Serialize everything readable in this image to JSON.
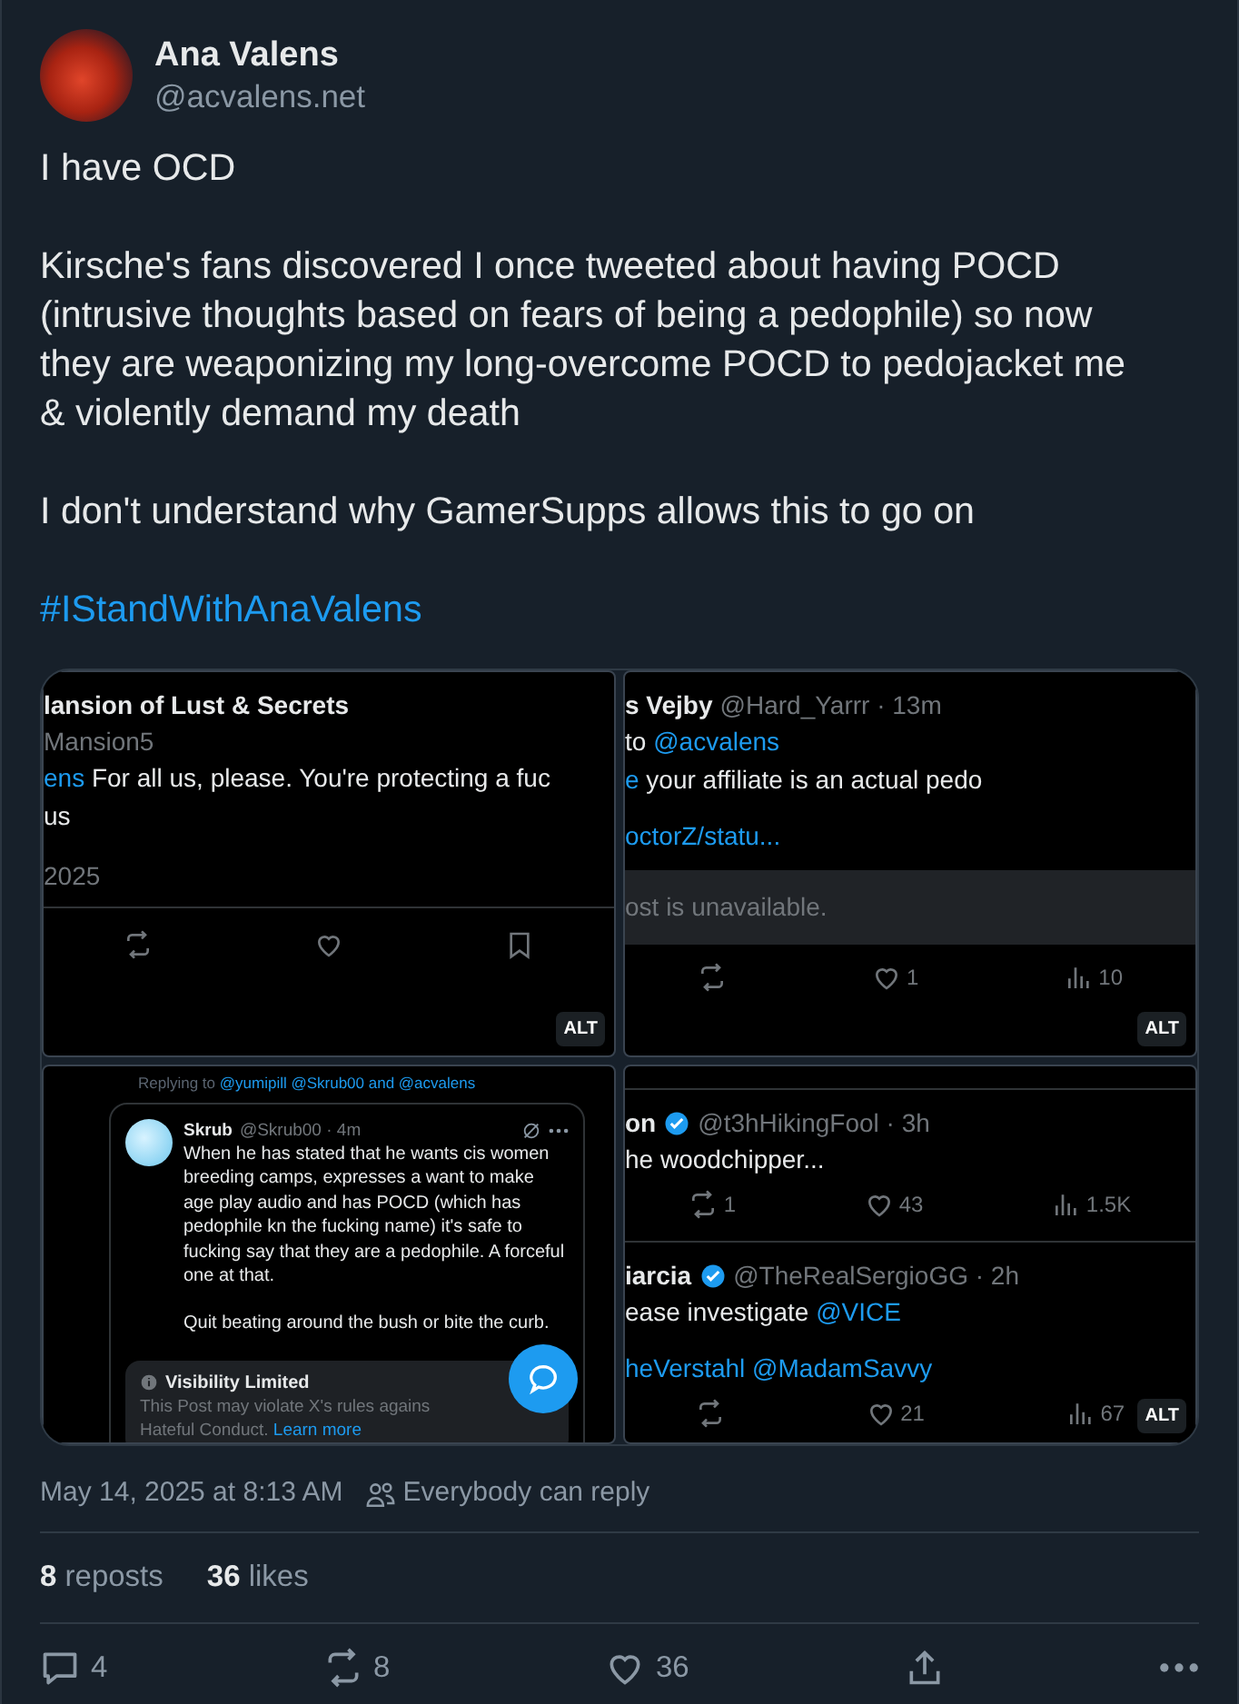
{
  "author": {
    "name": "Ana Valens",
    "handle": "@acvalens.net"
  },
  "paragraphs": [
    {
      "kind": "text",
      "text": "I have OCD"
    },
    {
      "kind": "text",
      "text": "Kirsche's fans discovered I once tweeted about having POCD (intrusive thoughts based on fears of being a pedophile) so now they are weaponizing my long-overcome POCD to pedojacket me & violently demand my death"
    },
    {
      "kind": "text",
      "text": "I don't understand why GamerSupps allows this to go on"
    },
    {
      "kind": "hashtag",
      "text": "#IStandWithAnaValens"
    }
  ],
  "images": [
    {
      "alt": "ALT",
      "fab": false,
      "blocks": [
        {
          "kind": "header",
          "name": "lansion of Lust & Secrets",
          "verified": false
        },
        {
          "kind": "muted",
          "text": "Mansion5"
        },
        {
          "kind": "text",
          "segments": [
            {
              "text": "ens",
              "link": true
            },
            {
              "text": " For all us, please. You're protecting a fuc",
              "link": false
            }
          ]
        },
        {
          "kind": "text",
          "segments": [
            {
              "text": "us",
              "link": false
            }
          ]
        },
        {
          "kind": "date",
          "text": "2025"
        },
        {
          "kind": "divider"
        },
        {
          "kind": "actions",
          "items": [
            {
              "kind": "repost"
            },
            {
              "kind": "like"
            },
            {
              "kind": "bookmark"
            }
          ]
        }
      ]
    },
    {
      "alt": "ALT",
      "fab": false,
      "blocks": [
        {
          "kind": "header",
          "name": "s Vejby",
          "verified": false,
          "handle": "@Hard_Yarrr · 13m"
        },
        {
          "kind": "text",
          "segments": [
            {
              "text": "to ",
              "link": false
            },
            {
              "text": "@acvalens",
              "link": true
            }
          ]
        },
        {
          "kind": "text",
          "segments": [
            {
              "text": "e",
              "link": true
            },
            {
              "text": " your affiliate is an actual pedo",
              "link": false
            }
          ]
        },
        {
          "kind": "gap"
        },
        {
          "kind": "text",
          "segments": [
            {
              "text": "octorZ/statu...",
              "link": true
            }
          ]
        },
        {
          "kind": "notice",
          "text": "ost is unavailable."
        },
        {
          "kind": "actions",
          "items": [
            {
              "kind": "repost"
            },
            {
              "kind": "like",
              "count": "1"
            },
            {
              "kind": "views",
              "count": "10"
            }
          ]
        }
      ]
    },
    {
      "fab": true,
      "blocks": [
        {
          "kind": "replying",
          "segments": [
            {
              "text": "Replying to ",
              "link": false
            },
            {
              "text": "@yumipill @Skrub00 and @acvalens",
              "link": true
            }
          ]
        },
        {
          "kind": "quote",
          "name": "Skrub",
          "handle": "@Skrub00 · 4m",
          "paragraphs": [
            "When he has stated that he wants cis women breeding camps, expresses a want to make age play audio and has POCD (which has pedophile kn the fucking name) it's safe to fucking say that they are a pedophile. A forceful one at that.",
            "Quit beating around the bush or bite the curb."
          ],
          "visibility": {
            "title": "Visibility Limited",
            "lines": [
              [
                {
                  "text": "This Post may violate X's rules agains",
                  "link": false
                }
              ],
              [
                {
                  "text": "Hateful Conduct. ",
                  "link": false
                },
                {
                  "text": "Learn more",
                  "link": true
                }
              ]
            ]
          }
        }
      ]
    },
    {
      "alt": "ALT",
      "fab": false,
      "blocks": [
        {
          "kind": "divider"
        },
        {
          "kind": "header",
          "name": "on",
          "verified": true,
          "handle": "@t3hHikingFool · 3h"
        },
        {
          "kind": "text",
          "segments": [
            {
              "text": "he woodchipper...",
              "link": false
            }
          ]
        },
        {
          "kind": "actions",
          "items": [
            {
              "kind": "repost",
              "count": "1"
            },
            {
              "kind": "like",
              "count": "43"
            },
            {
              "kind": "views",
              "count": "1.5K"
            }
          ]
        },
        {
          "kind": "divider"
        },
        {
          "kind": "header",
          "name": "iarcia",
          "verified": true,
          "handle": "@TheRealSergioGG · 2h"
        },
        {
          "kind": "text",
          "segments": [
            {
              "text": "ease investigate ",
              "link": false
            },
            {
              "text": "@VICE",
              "link": true
            }
          ]
        },
        {
          "kind": "gap"
        },
        {
          "kind": "text",
          "segments": [
            {
              "text": "heVerstahl @MadamSavvy",
              "link": true
            }
          ]
        },
        {
          "kind": "actions",
          "items": [
            {
              "kind": "repost"
            },
            {
              "kind": "like",
              "count": "21"
            },
            {
              "kind": "views",
              "count": "67"
            }
          ]
        }
      ]
    }
  ],
  "timestamp": "May 14, 2025 at 8:13 AM",
  "audience": "Everybody can reply",
  "stats": [
    {
      "count": "8",
      "label": "reposts"
    },
    {
      "count": "36",
      "label": "likes"
    }
  ],
  "actions": [
    {
      "kind": "reply",
      "count": "4"
    },
    {
      "kind": "repost",
      "count": "8"
    },
    {
      "kind": "like",
      "count": "36"
    },
    {
      "kind": "share"
    },
    {
      "kind": "more"
    }
  ]
}
